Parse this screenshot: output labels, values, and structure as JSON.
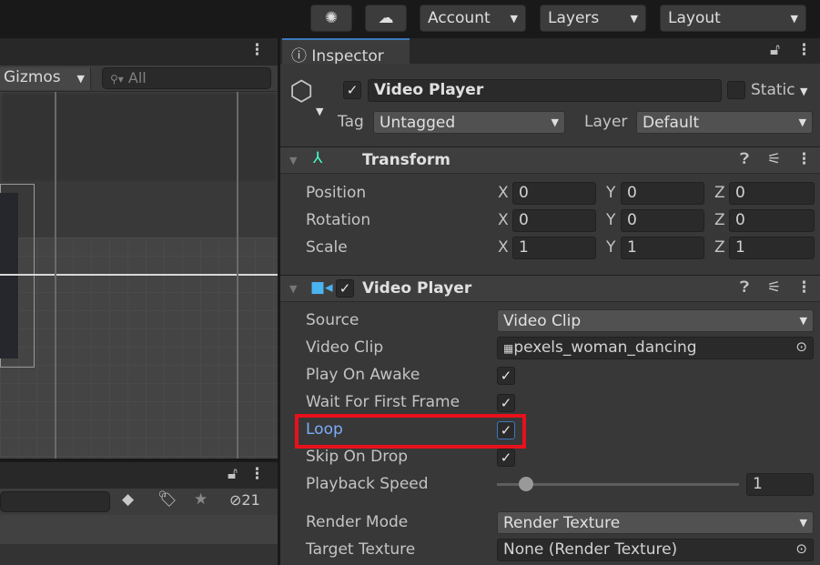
{
  "toolbar": {
    "account": "Account",
    "layers": "Layers",
    "layout": "Layout"
  },
  "scene": {
    "gizmos": "Gizmos",
    "search_placeholder": "All"
  },
  "hierarchy": {
    "hidden_count": "21"
  },
  "inspector": {
    "tab": "Inspector",
    "object_name": "Video Player",
    "static_label": "Static",
    "tag_label": "Tag",
    "tag_value": "Untagged",
    "layer_label": "Layer",
    "layer_value": "Default",
    "transform": {
      "title": "Transform",
      "rows": [
        {
          "label": "Position",
          "x": "0",
          "y": "0",
          "z": "0"
        },
        {
          "label": "Rotation",
          "x": "0",
          "y": "0",
          "z": "0"
        },
        {
          "label": "Scale",
          "x": "1",
          "y": "1",
          "z": "1"
        }
      ],
      "axes": {
        "x": "X",
        "y": "Y",
        "z": "Z"
      }
    },
    "video_player": {
      "title": "Video Player",
      "source_label": "Source",
      "source_value": "Video Clip",
      "clip_label": "Video Clip",
      "clip_value": "pexels_woman_dancing",
      "play_on_awake": "Play On Awake",
      "wait_first_frame": "Wait For First Frame",
      "loop": "Loop",
      "skip_on_drop": "Skip On Drop",
      "playback_speed_label": "Playback Speed",
      "playback_speed": "1",
      "render_mode_label": "Render Mode",
      "render_mode": "Render Texture",
      "target_texture_label": "Target Texture",
      "target_texture": "None (Render Texture)"
    }
  },
  "colors": {
    "highlight": "#e8111b",
    "accent": "#4c9ce0"
  }
}
